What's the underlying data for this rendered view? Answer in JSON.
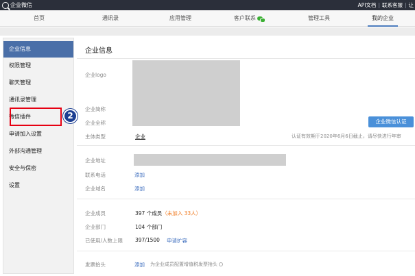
{
  "topbar": {
    "brand": "企业微信",
    "links": [
      "API文档",
      "联系客服",
      "让"
    ]
  },
  "nav": {
    "items": [
      "首页",
      "通讯录",
      "应用管理",
      "客户联系",
      "管理工具",
      "我的企业"
    ],
    "active": "我的企业"
  },
  "sidebar": {
    "items": [
      "企业信息",
      "权限管理",
      "聊天管理",
      "通讯录管理",
      "微信插件",
      "申请加入设置",
      "外部沟通管理",
      "安全与保密",
      "设置"
    ],
    "active": "企业信息",
    "highlighted": "微信插件",
    "step_badge": "2"
  },
  "main": {
    "title": "企业信息",
    "logo_label": "企业logo",
    "short_name_label": "企业简称",
    "full_name_label": "企业全称",
    "subject_type_label": "主体类型",
    "subject_type_value": "企业",
    "verify_button": "企业微信认证",
    "verify_note": "认证有效期于2020年6月6日截止，请尽快进行年审",
    "address_label": "企业地址",
    "phone_label": "联系电话",
    "phone_action": "添加",
    "domain_label": "企业域名",
    "domain_action": "添加",
    "members_label": "企业成员",
    "members_value": "397 个成员",
    "members_pending": "（未加入 33人）",
    "departments_label": "企业部门",
    "departments_value": "104 个部门",
    "limit_label": "已使用/人数上限",
    "limit_value": "397/1500",
    "limit_action": "申请扩容",
    "invoice_label": "发票抬头",
    "invoice_action": "添加",
    "invoice_note": "为企业成员配置增值税发票抬头"
  }
}
